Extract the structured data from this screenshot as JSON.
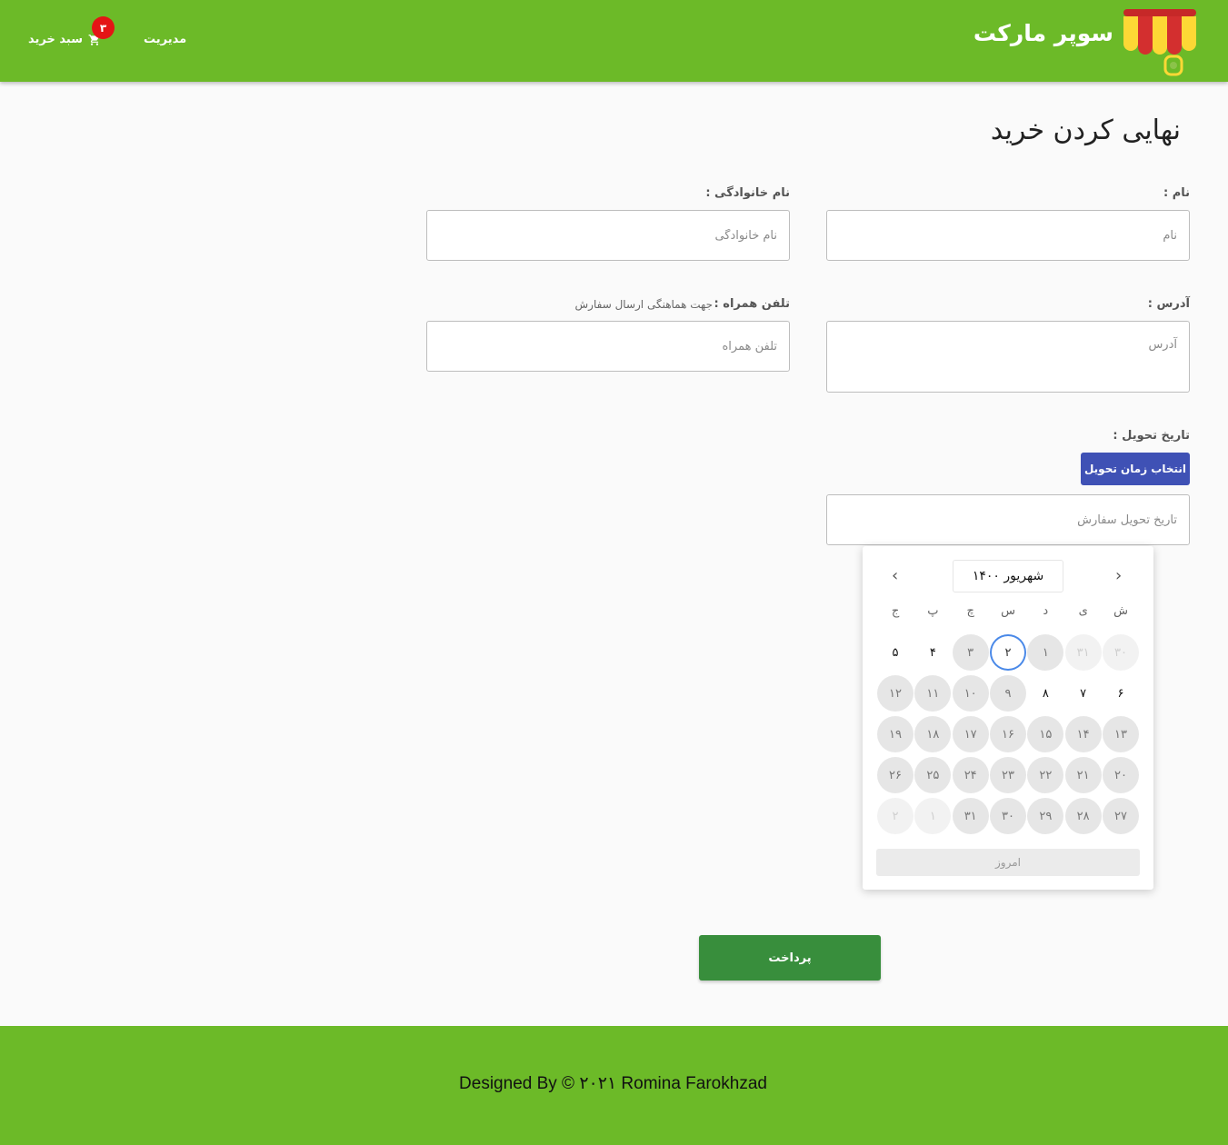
{
  "header": {
    "brand": "سوپر مارکت",
    "nav_admin": "مدیریت",
    "nav_cart": "سبد خرید",
    "cart_count": "۳",
    "logo_icon": "market-awning-icon",
    "cart_icon": "cart-icon",
    "colors": {
      "bar": "#6cba28",
      "badge": "#e41515"
    }
  },
  "page": {
    "title": "نهایی کردن خرید"
  },
  "form": {
    "first_name": {
      "label": "نام :",
      "placeholder": "نام"
    },
    "last_name": {
      "label": "نام خانوادگی :",
      "placeholder": "نام خانوادگی"
    },
    "address": {
      "label": "آدرس :",
      "placeholder": "آدرس"
    },
    "phone": {
      "label": "تلفن همراه :",
      "hint": "جهت هماهنگی ارسال سفارش",
      "placeholder": "تلفن همراه"
    },
    "delivery": {
      "label": "تاریخ تحویل :",
      "button": "انتخاب زمان تحویل",
      "placeholder": "تاریخ تحویل سفارش"
    }
  },
  "calendar": {
    "month_label": "شهریور ۱۴۰۰",
    "weekdays": [
      "ش",
      "ی",
      "د",
      "س",
      "چ",
      "پ",
      "ج"
    ],
    "weeks": [
      [
        {
          "d": "۳۰",
          "s": "out"
        },
        {
          "d": "۳۱",
          "s": "out"
        },
        {
          "d": "۱",
          "s": "dis"
        },
        {
          "d": "۲",
          "s": "sel"
        },
        {
          "d": "۳",
          "s": "dis"
        },
        {
          "d": "۴",
          "s": "act"
        },
        {
          "d": "۵",
          "s": "act"
        }
      ],
      [
        {
          "d": "۶",
          "s": "act"
        },
        {
          "d": "۷",
          "s": "act"
        },
        {
          "d": "۸",
          "s": "act"
        },
        {
          "d": "۹",
          "s": "dis"
        },
        {
          "d": "۱۰",
          "s": "dis"
        },
        {
          "d": "۱۱",
          "s": "dis"
        },
        {
          "d": "۱۲",
          "s": "dis"
        }
      ],
      [
        {
          "d": "۱۳",
          "s": "dis"
        },
        {
          "d": "۱۴",
          "s": "dis"
        },
        {
          "d": "۱۵",
          "s": "dis"
        },
        {
          "d": "۱۶",
          "s": "dis"
        },
        {
          "d": "۱۷",
          "s": "dis"
        },
        {
          "d": "۱۸",
          "s": "dis"
        },
        {
          "d": "۱۹",
          "s": "dis"
        }
      ],
      [
        {
          "d": "۲۰",
          "s": "dis"
        },
        {
          "d": "۲۱",
          "s": "dis"
        },
        {
          "d": "۲۲",
          "s": "dis"
        },
        {
          "d": "۲۳",
          "s": "dis"
        },
        {
          "d": "۲۴",
          "s": "dis"
        },
        {
          "d": "۲۵",
          "s": "dis"
        },
        {
          "d": "۲۶",
          "s": "dis"
        }
      ],
      [
        {
          "d": "۲۷",
          "s": "dis"
        },
        {
          "d": "۲۸",
          "s": "dis"
        },
        {
          "d": "۲۹",
          "s": "dis"
        },
        {
          "d": "۳۰",
          "s": "dis"
        },
        {
          "d": "۳۱",
          "s": "dis"
        },
        {
          "d": "۱",
          "s": "out"
        },
        {
          "d": "۲",
          "s": "out"
        }
      ]
    ],
    "today_button": "امروز",
    "prev_icon": "chevron-right-icon",
    "next_icon": "chevron-left-icon"
  },
  "actions": {
    "pay": "پرداخت"
  },
  "footer": {
    "text": "Designed By © ۲۰۲۱ Romina Farokhzad"
  }
}
